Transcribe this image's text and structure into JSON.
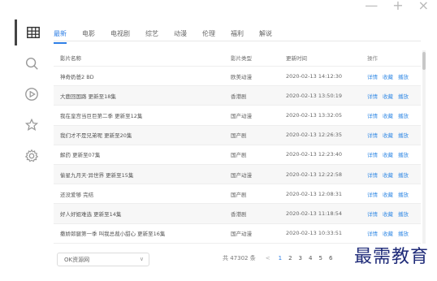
{
  "window": {
    "minimize": "—",
    "maximize": "+",
    "close": "×"
  },
  "tabs": [
    "最新",
    "电影",
    "电视剧",
    "综艺",
    "动漫",
    "伦理",
    "福利",
    "解说"
  ],
  "table": {
    "headers": {
      "name": "影片名称",
      "type": "影片类型",
      "time": "更新时间",
      "actions": "操作"
    },
    "rows": [
      {
        "name": "神奇奶爸2 BD",
        "type": "欧美动漫",
        "time": "2020-02-13 14:12:30"
      },
      {
        "name": "大鹿回国路 更新至18集",
        "type": "香港剧",
        "time": "2020-02-13 13:50:19"
      },
      {
        "name": "我在皇宫当巨巨第二季 更新至12集",
        "type": "国产动漫",
        "time": "2020-02-13 13:32:05"
      },
      {
        "name": "我们才不是兄弟呢 更新至20集",
        "type": "国产剧",
        "time": "2020-02-13 12:26:35"
      },
      {
        "name": "解药 更新至07集",
        "type": "国产剧",
        "time": "2020-02-13 12:23:40"
      },
      {
        "name": "偷星九月天·异世界 更新至15集",
        "type": "国产动漫",
        "time": "2020-02-13 12:22:58"
      },
      {
        "name": "还没爱够 完结",
        "type": "国产剧",
        "time": "2020-02-13 12:08:31"
      },
      {
        "name": "好人好姐难选 更新至14集",
        "type": "香港剧",
        "time": "2020-02-13 11:18:54"
      },
      {
        "name": "撒娇郎腿第一季 叫我总裁小甜心 更新至16集",
        "type": "国产动漫",
        "time": "2020-02-13 10:33:51"
      }
    ],
    "action_labels": {
      "detail": "详情",
      "favorite": "收藏",
      "play": "播放"
    }
  },
  "source_select": {
    "value": "OK资源网",
    "caret": "∨"
  },
  "pagination": {
    "total": "共 47302 条",
    "prev": "<",
    "pages": [
      "1",
      "2",
      "3",
      "4",
      "5",
      "6"
    ],
    "active": "1"
  },
  "watermark": "最需教育",
  "colors": {
    "accent": "#2f7fe6",
    "link": "#3a8ee6"
  },
  "icons": [
    "table-icon",
    "search-icon",
    "play-icon",
    "star-icon",
    "gear-icon"
  ]
}
